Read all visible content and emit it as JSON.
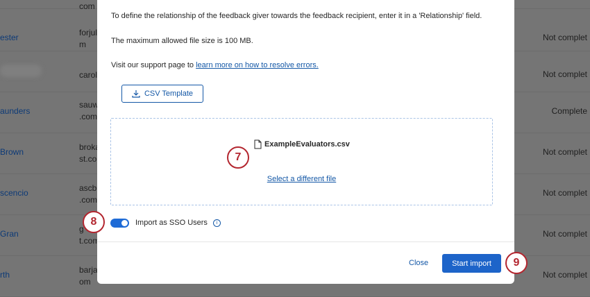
{
  "background_rows": [
    {
      "name": "",
      "email": "com",
      "status": ""
    },
    {
      "name": "ester",
      "email": "forjul m",
      "status": "Not complet"
    },
    {
      "name": "",
      "email": "caroli",
      "status": "Not complet"
    },
    {
      "name": "aunders",
      "email": "sauw .com",
      "status": "Complete"
    },
    {
      "name": "Brown",
      "email": "broka st.com",
      "status": "Not complet"
    },
    {
      "name": "scencio",
      "email": "ascbl .com",
      "status": "Not complet"
    },
    {
      "name": "Gran",
      "email": "g t.com",
      "status": "Not complet"
    },
    {
      "name": "rth",
      "email": "barja om",
      "status": "Not complet"
    }
  ],
  "modal": {
    "relationship_text": "To define the relationship of the feedback giver towards the feedback recipient, enter it in a 'Relationship' field.",
    "file_size_text": "The maximum allowed file size is 100 MB.",
    "support_prefix": "Visit our support page to ",
    "support_link": "learn more on how to resolve errors.",
    "csv_template_label": "CSV Template",
    "file_name": "ExampleEvaluators.csv",
    "select_different_file": "Select a different file",
    "sso_toggle_on": true,
    "sso_label": "Import as SSO Users",
    "info_glyph": "i",
    "close_label": "Close",
    "start_import_label": "Start import"
  },
  "callouts": {
    "c7": "7",
    "c8": "8",
    "c9": "9"
  },
  "colors": {
    "accent": "#1d64c9",
    "link": "#1357a6",
    "callout": "#b3262f"
  }
}
